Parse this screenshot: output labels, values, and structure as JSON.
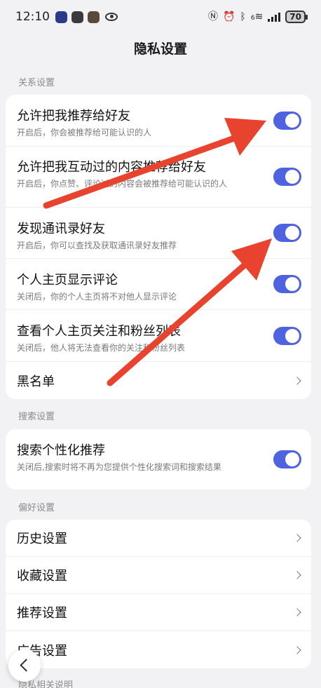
{
  "status_bar": {
    "time": "12:10",
    "battery": "70",
    "network_label": "6",
    "icons": [
      "nfc-icon",
      "alarm-icon",
      "bluetooth-icon",
      "wifi-icon",
      "signal-icon",
      "battery-icon"
    ]
  },
  "header": {
    "title": "隐私设置"
  },
  "sections": {
    "relations": {
      "label": "关系设置",
      "rows": [
        {
          "title": "允许把我推荐给好友",
          "subtitle": "开启后，你会被推荐给可能认识的人",
          "toggle": true
        },
        {
          "title": "允许把我互动过的内容推荐给好友",
          "subtitle": "开启后，你点赞、评论过的内容会被推荐给可能认识的人",
          "toggle": true
        },
        {
          "title": "发现通讯录好友",
          "subtitle": "开启后，你可以查找及获取通讯录好友推荐",
          "toggle": true
        },
        {
          "title": "个人主页显示评论",
          "subtitle": "关闭后，你的个人主页将不对他人显示评论",
          "toggle": true
        },
        {
          "title": "查看个人主页关注和粉丝列表",
          "subtitle": "关闭后，他人将无法查看你的关注和粉丝列表",
          "toggle": true
        }
      ],
      "blacklist": "黑名单"
    },
    "search": {
      "label": "搜索设置",
      "row": {
        "title": "搜索个性化推荐",
        "subtitle": "关闭后,搜索时将不再为您提供个性化搜索词和搜索结果",
        "toggle": true
      }
    },
    "preferences": {
      "label": "偏好设置",
      "items": [
        "历史设置",
        "收藏设置",
        "推荐设置",
        "广告设置"
      ]
    },
    "footer_label": "隐私相关说明"
  },
  "annotation_color": "#e8432e",
  "toggle_color": "#4f63e0"
}
